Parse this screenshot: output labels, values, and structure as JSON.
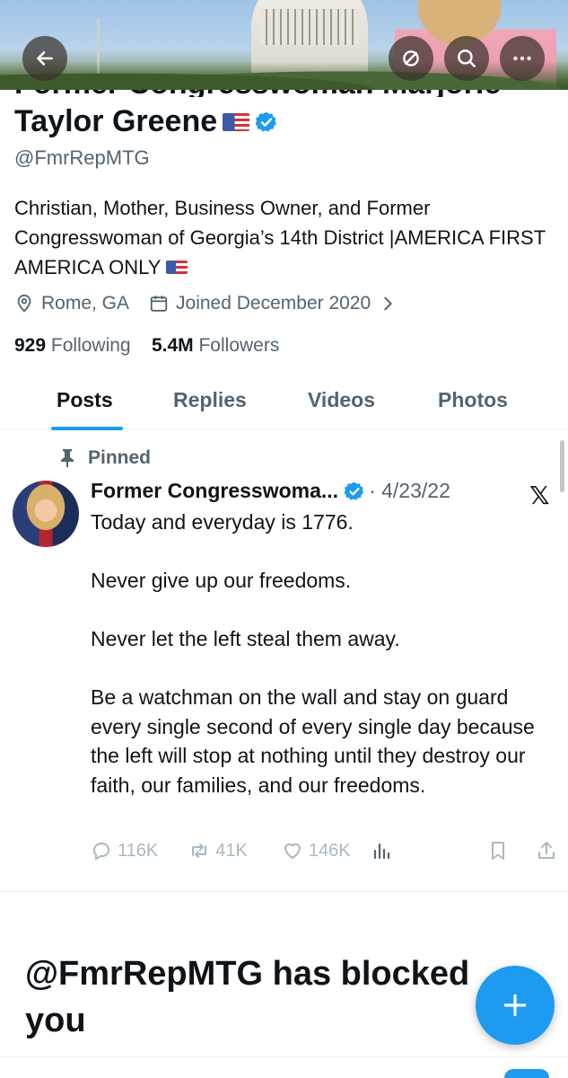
{
  "header": {
    "display_name_line1": "Former Congresswoman Marjorie",
    "display_name_line2": "Taylor Greene",
    "handle": "@FmrRepMTG"
  },
  "bio": "Christian, Mother, Business Owner, and Former Congresswoman of Georgia’s 14th District |AMERICA FIRST AMERICA ONLY",
  "meta": {
    "location": "Rome, GA",
    "joined": "Joined December 2020"
  },
  "stats": {
    "following_count": "929",
    "following_label": "Following",
    "followers_count": "5.4M",
    "followers_label": "Followers"
  },
  "tabs": [
    {
      "label": "Posts",
      "active": true
    },
    {
      "label": "Replies",
      "active": false
    },
    {
      "label": "Videos",
      "active": false
    },
    {
      "label": "Photos",
      "active": false
    }
  ],
  "post": {
    "pinned_label": "Pinned",
    "author": "Former Congresswoma...",
    "date": "· 4/23/22",
    "body": "Today and everyday is 1776.\n\nNever give up our freedoms.\n\nNever let the left steal them away.\n\nBe a watchman on the wall and stay on guard every single second of every single day because the left will stop at nothing until they destroy our faith, our families, and our freedoms.",
    "replies": "116K",
    "reposts": "41K",
    "likes": "146K"
  },
  "blocked_message": "@FmrRepMTG has blocked you",
  "colors": {
    "accent": "#1d9bf0",
    "text_primary": "#0f1419",
    "text_secondary": "#536471",
    "action_muted": "#aab8c2"
  },
  "icons": [
    "back-arrow-icon",
    "repost-circle-icon",
    "search-icon",
    "more-icon",
    "verified-badge-icon",
    "us-flag-icon",
    "location-pin-icon",
    "calendar-icon",
    "chevron-right-icon",
    "pin-icon",
    "x-logo-icon",
    "reply-icon",
    "repost-icon",
    "like-icon",
    "views-icon",
    "bookmark-icon",
    "share-icon",
    "plus-icon"
  ]
}
